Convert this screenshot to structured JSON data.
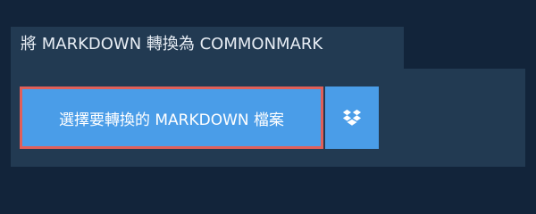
{
  "header": {
    "title": "將 MARKDOWN 轉換為 COMMONMARK"
  },
  "upload": {
    "select_label": "選擇要轉換的 MARKDOWN 檔案",
    "dropbox_icon": "dropbox-icon"
  },
  "colors": {
    "page_background": "#12243a",
    "panel_background": "#223a52",
    "button_background": "#4a9de8",
    "highlight_border": "#e0605a",
    "text": "#ffffff"
  }
}
